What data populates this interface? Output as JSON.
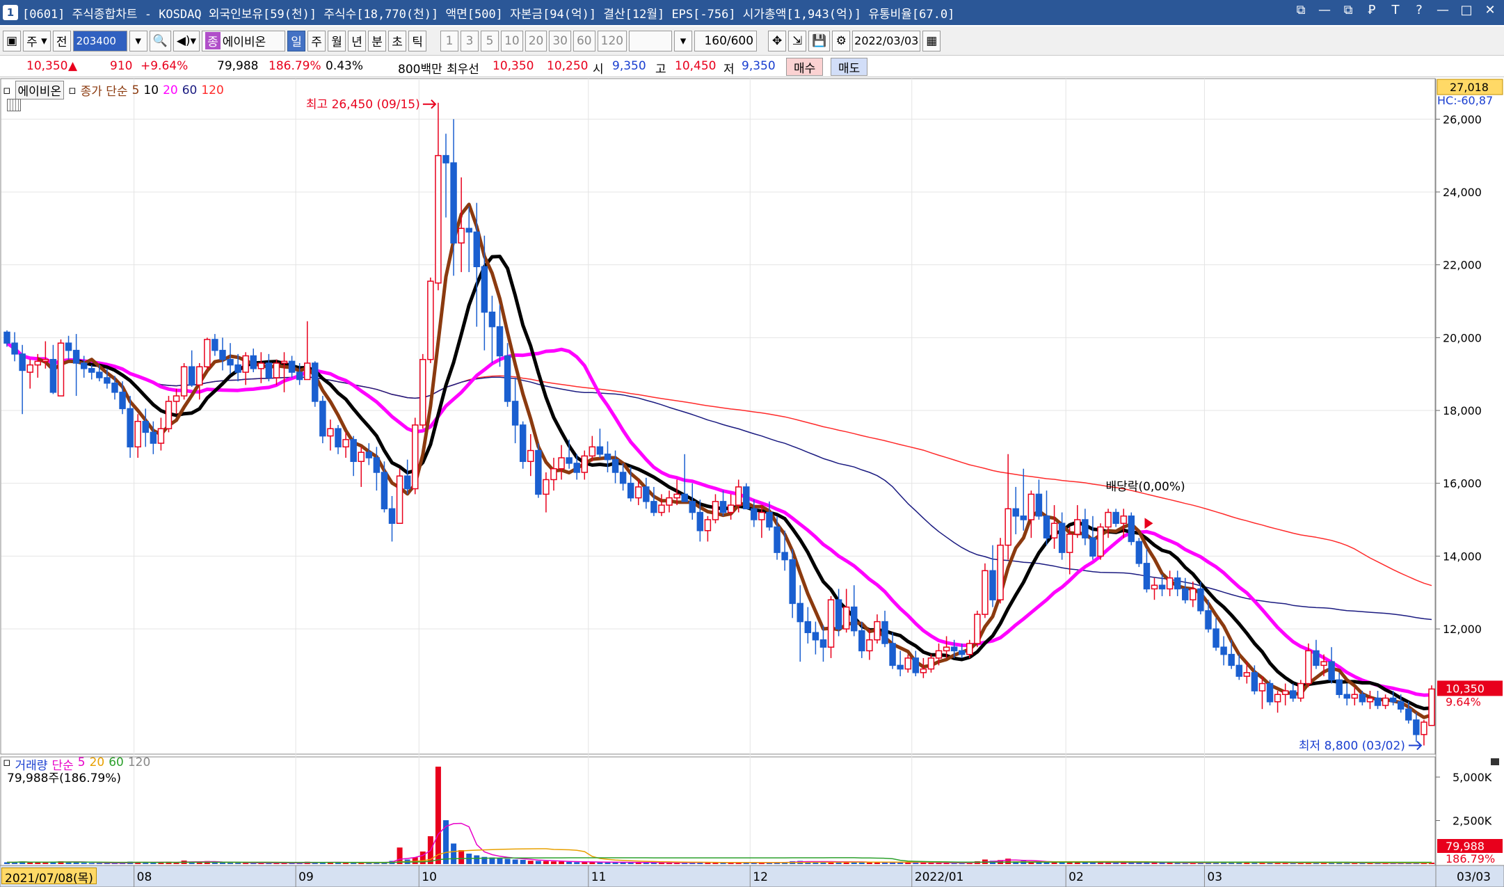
{
  "window": {
    "number": "1",
    "title": "[0601] 주식종합차트 - KOSDAQ 외국인보유[59(천)] 주식수[18,770(천)] 액면[500] 자본금[94(억)] 결산[12월] EPS[-756] 시가총액[1,943(억)] 유통비율[67.0]",
    "controls": [
      "⧉",
      "—",
      "⧉",
      "Ꝑ",
      "T",
      "?",
      "—",
      "□",
      "✕"
    ]
  },
  "toolbar": {
    "market": "주",
    "prefix": "전",
    "code": "203400",
    "stock_tag": "종",
    "stock_name": "에이비온",
    "periods": [
      "일",
      "주",
      "월",
      "년",
      "분",
      "초",
      "틱"
    ],
    "selected_period": "일",
    "intervals": [
      "1",
      "3",
      "5",
      "10",
      "20",
      "30",
      "60",
      "120"
    ],
    "count": "160",
    "total": "/600",
    "date": "2022/03/03"
  },
  "quote": {
    "price": "10,350",
    "arrow": "▲",
    "change": "910",
    "change_pct": "+9.64%",
    "volume": "79,988",
    "volume_pct": "186.79%",
    "turnover": "0.43%",
    "amount_label": "800백만",
    "bid_label": "최우선",
    "ask": "10,350",
    "bid": "10,250",
    "open_label": "시",
    "open": "9,350",
    "high_label": "고",
    "high": "10,450",
    "low_label": "저",
    "low": "9,350",
    "buy_label": "매수",
    "sell_label": "매도"
  },
  "legend": {
    "name": "에이비온",
    "close_label": "종가 단순",
    "ma": [
      "5",
      "10",
      "20",
      "60",
      "120"
    ],
    "ma_colors": [
      "#8B3A0F",
      "#000000",
      "#ff00ff",
      "#1a1a80",
      "#ff2a2a"
    ],
    "volume_label": "거래량",
    "volume_ma_label": "단순",
    "volume_ma": [
      "5",
      "20",
      "60",
      "120"
    ],
    "volume_ma_colors": [
      "#e800c8",
      "#e8a000",
      "#2ca02c",
      "#888888"
    ],
    "volume_info": "79,988주(186.79%)"
  },
  "annotations": {
    "high": "최고 26,450 (09/15)",
    "low": "최저 8,800 (03/02)",
    "ex_div": "배당락(0,00%)"
  },
  "axis": {
    "top_value": "27,018",
    "hc_label": "HC:-60,87",
    "price_ticks": [
      "26,000",
      "24,000",
      "22,000",
      "20,000",
      "18,000",
      "16,000",
      "14,000",
      "12,000"
    ],
    "price_ticks_values": [
      26000,
      24000,
      22000,
      20000,
      18000,
      16000,
      14000,
      12000
    ],
    "current_price": "10,350",
    "current_pct": "9.64%",
    "volume_ticks": [
      "5,000K",
      "2,500K"
    ],
    "volume_current": "79,988",
    "volume_current_pct": "186.79%",
    "start_date": "2021/07/08(목)",
    "end_date": "03/03",
    "month_labels": [
      "08",
      "09",
      "10",
      "11",
      "12",
      "2022/01",
      "02",
      "03"
    ]
  },
  "chart_data": {
    "type": "candlestick",
    "y_range": [
      8600,
      27018
    ],
    "volume_range": [
      0,
      6000
    ],
    "candles": [
      [
        20150,
        20200,
        19750,
        19850,
        100
      ],
      [
        19850,
        20150,
        19350,
        19550,
        110
      ],
      [
        19550,
        19800,
        17900,
        19100,
        150
      ],
      [
        19050,
        19400,
        18600,
        19250,
        90
      ],
      [
        19250,
        19550,
        18900,
        19350,
        80
      ],
      [
        19350,
        19900,
        19150,
        19400,
        90
      ],
      [
        19400,
        19800,
        18450,
        18500,
        140
      ],
      [
        18400,
        19950,
        18400,
        19850,
        160
      ],
      [
        19850,
        20050,
        19400,
        19650,
        120
      ],
      [
        19650,
        20100,
        18400,
        19300,
        110
      ],
      [
        19300,
        19500,
        18900,
        19150,
        70
      ],
      [
        19150,
        19250,
        18850,
        19050,
        60
      ],
      [
        19050,
        19250,
        18800,
        18900,
        55
      ],
      [
        18900,
        19150,
        18600,
        18750,
        55
      ],
      [
        18750,
        18950,
        18300,
        18500,
        60
      ],
      [
        18500,
        18800,
        17900,
        18050,
        65
      ],
      [
        18050,
        18400,
        16700,
        17000,
        140
      ],
      [
        17000,
        17900,
        16700,
        17700,
        120
      ],
      [
        17700,
        18050,
        17000,
        17400,
        90
      ],
      [
        17400,
        17700,
        16800,
        17100,
        80
      ],
      [
        17100,
        17800,
        16900,
        17500,
        85
      ],
      [
        17500,
        18400,
        17400,
        18250,
        130
      ],
      [
        18250,
        18600,
        17900,
        18400,
        90
      ],
      [
        18400,
        19300,
        18300,
        19200,
        200
      ],
      [
        19200,
        19650,
        18650,
        18700,
        120
      ],
      [
        18700,
        19300,
        18300,
        19200,
        100
      ],
      [
        19200,
        20000,
        19100,
        19950,
        170
      ],
      [
        19950,
        20100,
        19500,
        19650,
        110
      ],
      [
        19650,
        20000,
        19100,
        19400,
        80
      ],
      [
        19400,
        19850,
        19000,
        19250,
        70
      ],
      [
        19250,
        19550,
        18800,
        19050,
        65
      ],
      [
        19050,
        19600,
        18700,
        19500,
        80
      ],
      [
        19500,
        19700,
        19050,
        19150,
        70
      ],
      [
        19150,
        19600,
        18750,
        19300,
        75
      ],
      [
        19300,
        19550,
        18800,
        18900,
        60
      ],
      [
        18900,
        19400,
        18700,
        19300,
        65
      ],
      [
        19300,
        19600,
        18500,
        19350,
        60
      ],
      [
        19350,
        19500,
        18900,
        19050,
        55
      ],
      [
        19050,
        19300,
        18700,
        18850,
        60
      ],
      [
        18850,
        20450,
        18850,
        19300,
        130
      ],
      [
        19300,
        19350,
        18100,
        18250,
        90
      ],
      [
        18250,
        18400,
        17100,
        17300,
        95
      ],
      [
        17300,
        17750,
        16900,
        17500,
        110
      ],
      [
        17500,
        17600,
        16800,
        17000,
        80
      ],
      [
        17000,
        17400,
        16700,
        17200,
        70
      ],
      [
        17200,
        17300,
        16200,
        16600,
        90
      ],
      [
        16600,
        17000,
        15900,
        16850,
        100
      ],
      [
        16850,
        17100,
        16500,
        16700,
        70
      ],
      [
        16700,
        17000,
        15800,
        16300,
        90
      ],
      [
        16300,
        16600,
        15200,
        15300,
        120
      ],
      [
        15300,
        15650,
        14400,
        14900,
        180
      ],
      [
        14900,
        16400,
        14900,
        16200,
        950
      ],
      [
        16200,
        16650,
        15700,
        15850,
        260
      ],
      [
        15850,
        17800,
        15700,
        17600,
        380
      ],
      [
        17600,
        19550,
        17500,
        19400,
        720
      ],
      [
        19400,
        21650,
        19300,
        21550,
        1600
      ],
      [
        21500,
        26450,
        21300,
        25000,
        5600
      ],
      [
        25000,
        25600,
        23300,
        24800,
        2520
      ],
      [
        24800,
        26000,
        21700,
        22600,
        1180
      ],
      [
        22600,
        24400,
        21800,
        23000,
        800
      ],
      [
        23000,
        23600,
        21800,
        22900,
        600
      ],
      [
        22900,
        23700,
        20300,
        21950,
        500
      ],
      [
        21950,
        22800,
        19650,
        20700,
        410
      ],
      [
        20700,
        21150,
        19300,
        20300,
        380
      ],
      [
        20300,
        20900,
        19200,
        19500,
        340
      ],
      [
        19500,
        19850,
        18100,
        18250,
        300
      ],
      [
        18250,
        18900,
        17100,
        17600,
        260
      ],
      [
        17600,
        17700,
        16400,
        16600,
        240
      ],
      [
        16600,
        17350,
        16200,
        16900,
        190
      ],
      [
        16900,
        17100,
        15600,
        15700,
        180
      ],
      [
        15700,
        16300,
        15200,
        16100,
        170
      ],
      [
        16100,
        16700,
        15800,
        16400,
        150
      ],
      [
        16400,
        17050,
        16100,
        16700,
        140
      ],
      [
        16700,
        17200,
        16400,
        16550,
        120
      ],
      [
        16550,
        16800,
        16100,
        16300,
        110
      ],
      [
        16300,
        16900,
        16100,
        16750,
        120
      ],
      [
        16750,
        17300,
        16600,
        17000,
        130
      ],
      [
        17000,
        17500,
        16700,
        16800,
        100
      ],
      [
        16800,
        17150,
        16300,
        16650,
        90
      ],
      [
        16650,
        16900,
        16000,
        16300,
        100
      ],
      [
        16300,
        16550,
        15800,
        16000,
        100
      ],
      [
        16000,
        16450,
        15500,
        15600,
        110
      ],
      [
        15600,
        16100,
        15400,
        15900,
        80
      ],
      [
        15900,
        16150,
        15300,
        15500,
        90
      ],
      [
        15500,
        15900,
        15100,
        15200,
        90
      ],
      [
        15200,
        15700,
        15100,
        15400,
        70
      ],
      [
        15400,
        15800,
        15200,
        15600,
        70
      ],
      [
        15600,
        16100,
        15400,
        15700,
        80
      ],
      [
        15700,
        16800,
        15500,
        15500,
        100
      ],
      [
        15500,
        16000,
        15000,
        15200,
        90
      ],
      [
        15200,
        15550,
        14400,
        14700,
        110
      ],
      [
        14700,
        15100,
        14400,
        15000,
        70
      ],
      [
        15000,
        15700,
        14900,
        15500,
        80
      ],
      [
        15500,
        15800,
        15100,
        15200,
        70
      ],
      [
        15200,
        15700,
        15000,
        15400,
        70
      ],
      [
        15400,
        16100,
        15200,
        15900,
        120
      ],
      [
        15900,
        16000,
        15300,
        15300,
        80
      ],
      [
        15300,
        15550,
        14800,
        15000,
        70
      ],
      [
        15000,
        15400,
        14500,
        15200,
        60
      ],
      [
        15200,
        15500,
        14700,
        14800,
        70
      ],
      [
        14800,
        15100,
        13900,
        14100,
        120
      ],
      [
        14100,
        14700,
        13600,
        13900,
        110
      ],
      [
        13900,
        14200,
        12300,
        12700,
        160
      ],
      [
        12700,
        13200,
        11100,
        12200,
        180
      ],
      [
        12200,
        12600,
        11600,
        11900,
        130
      ],
      [
        11900,
        12200,
        11300,
        11700,
        120
      ],
      [
        11700,
        12100,
        11100,
        11500,
        110
      ],
      [
        11500,
        12900,
        11200,
        12800,
        150
      ],
      [
        12800,
        13100,
        11800,
        12000,
        120
      ],
      [
        12000,
        13100,
        11900,
        12600,
        130
      ],
      [
        12600,
        13200,
        11800,
        11950,
        110
      ],
      [
        11950,
        12200,
        11200,
        11400,
        110
      ],
      [
        11400,
        12000,
        11150,
        11700,
        100
      ],
      [
        11700,
        12400,
        11600,
        12200,
        100
      ],
      [
        12200,
        12500,
        11500,
        11600,
        80
      ],
      [
        11600,
        11900,
        10900,
        11000,
        110
      ],
      [
        11000,
        11400,
        10700,
        10900,
        110
      ],
      [
        10900,
        11300,
        10800,
        11200,
        90
      ],
      [
        11200,
        11400,
        10700,
        10800,
        90
      ],
      [
        10800,
        11200,
        10650,
        10900,
        80
      ],
      [
        10900,
        11300,
        10800,
        11200,
        70
      ],
      [
        11200,
        11600,
        11000,
        11400,
        80
      ],
      [
        11400,
        11800,
        11200,
        11500,
        70
      ],
      [
        11500,
        11700,
        11200,
        11400,
        60
      ],
      [
        11400,
        11600,
        11200,
        11300,
        60
      ],
      [
        11300,
        11700,
        11200,
        11600,
        80
      ],
      [
        11600,
        12500,
        11500,
        12400,
        160
      ],
      [
        12400,
        13800,
        12300,
        13600,
        260
      ],
      [
        13600,
        14300,
        12600,
        12800,
        190
      ],
      [
        12800,
        14500,
        12700,
        14300,
        230
      ],
      [
        14300,
        16800,
        13900,
        15300,
        310
      ],
      [
        15300,
        15900,
        14600,
        15100,
        160
      ],
      [
        15100,
        16400,
        14700,
        15000,
        180
      ],
      [
        15000,
        15800,
        14500,
        15700,
        140
      ],
      [
        15700,
        16100,
        15000,
        15100,
        120
      ],
      [
        15100,
        15800,
        14300,
        14500,
        120
      ],
      [
        14500,
        15400,
        14200,
        14900,
        110
      ],
      [
        14900,
        15200,
        13900,
        14100,
        110
      ],
      [
        14100,
        14800,
        13500,
        14600,
        110
      ],
      [
        14600,
        15400,
        14500,
        15000,
        100
      ],
      [
        15000,
        15300,
        14300,
        14500,
        90
      ],
      [
        14500,
        15100,
        13900,
        14000,
        90
      ],
      [
        14000,
        14900,
        13900,
        14800,
        90
      ],
      [
        14800,
        15300,
        14500,
        15200,
        90
      ],
      [
        15200,
        15300,
        14800,
        14900,
        80
      ],
      [
        14900,
        15300,
        14500,
        15100,
        80
      ],
      [
        15100,
        15200,
        14300,
        14400,
        90
      ],
      [
        14400,
        14500,
        13700,
        13800,
        110
      ],
      [
        13800,
        14200,
        13000,
        13100,
        120
      ],
      [
        13100,
        13400,
        12800,
        13200,
        80
      ],
      [
        13200,
        13500,
        12900,
        13100,
        70
      ],
      [
        13100,
        13600,
        12900,
        13400,
        80
      ],
      [
        13400,
        13600,
        12900,
        13100,
        70
      ],
      [
        13100,
        13400,
        12700,
        12800,
        80
      ],
      [
        12800,
        13300,
        12600,
        13100,
        70
      ],
      [
        13100,
        13300,
        12400,
        12500,
        80
      ],
      [
        12500,
        12800,
        11900,
        12000,
        90
      ],
      [
        12000,
        12300,
        11400,
        11500,
        100
      ],
      [
        11500,
        11800,
        11000,
        11300,
        90
      ],
      [
        11300,
        11700,
        10900,
        11000,
        90
      ],
      [
        11000,
        11300,
        10600,
        10700,
        80
      ],
      [
        10700,
        11100,
        10500,
        10800,
        80
      ],
      [
        10800,
        11000,
        10200,
        10300,
        90
      ],
      [
        10300,
        10700,
        9800,
        10500,
        80
      ],
      [
        10500,
        10600,
        9900,
        10000,
        80
      ],
      [
        10000,
        10300,
        9700,
        10200,
        70
      ],
      [
        10200,
        10500,
        9900,
        10300,
        70
      ],
      [
        10300,
        10500,
        10000,
        10100,
        60
      ],
      [
        10100,
        10600,
        10000,
        10500,
        70
      ],
      [
        10500,
        11600,
        10400,
        11400,
        120
      ],
      [
        11400,
        11700,
        10900,
        11000,
        90
      ],
      [
        11000,
        11300,
        10700,
        11100,
        70
      ],
      [
        11100,
        11500,
        10500,
        10600,
        80
      ],
      [
        10600,
        10800,
        10100,
        10200,
        80
      ],
      [
        10200,
        10500,
        9900,
        10100,
        70
      ],
      [
        10100,
        10400,
        9900,
        10200,
        60
      ],
      [
        10200,
        10300,
        9900,
        10000,
        60
      ],
      [
        10000,
        10300,
        9800,
        10100,
        60
      ],
      [
        10100,
        10300,
        9800,
        9900,
        60
      ],
      [
        9900,
        10200,
        9800,
        10100,
        50
      ],
      [
        10100,
        10300,
        9900,
        10000,
        50
      ],
      [
        10000,
        10200,
        9700,
        9800,
        60
      ],
      [
        9800,
        10000,
        9400,
        9500,
        70
      ],
      [
        9500,
        9700,
        8900,
        9100,
        80
      ],
      [
        9100,
        9500,
        8800,
        9440,
        60
      ],
      [
        9350,
        10450,
        9350,
        10350,
        80
      ]
    ],
    "ma_periods": [
      5,
      10,
      20,
      60,
      120
    ],
    "volume_ticks_values": [
      5000,
      2500
    ],
    "month_starts": [
      17,
      38,
      54,
      76,
      97,
      118,
      138,
      156
    ]
  }
}
